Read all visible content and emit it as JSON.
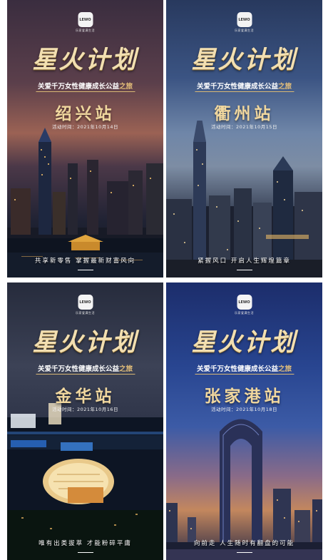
{
  "posters": [
    {
      "logo": "LEWO",
      "logo_sub": "乐家爱满生活",
      "title": "星火计划",
      "subtitle_pre": "关爱千万女性健康成长公益",
      "subtitle_hl": "之旅",
      "station": "绍兴站",
      "date": "活动时间：2021年10月14日",
      "slogan": "共享新零售  掌握最新财富风向"
    },
    {
      "logo": "LEWO",
      "logo_sub": "乐家爱满生活",
      "title": "星火计划",
      "subtitle_pre": "关爱千万女性健康成长公益",
      "subtitle_hl": "之旅",
      "station": "衢州站",
      "date": "活动时间：2021年10月15日",
      "slogan": "紧握风口  开启人生辉煌篇章"
    },
    {
      "logo": "LEWO",
      "logo_sub": "乐家爱满生活",
      "title": "星火计划",
      "subtitle_pre": "关爱千万女性健康成长公益",
      "subtitle_hl": "之旅",
      "station": "金华站",
      "date": "活动时间：2021年10月16日",
      "slogan": "唯有出类拔萃  才能粉碎平庸"
    },
    {
      "logo": "LEWO",
      "logo_sub": "乐家爱满生活",
      "title": "星火计划",
      "subtitle_pre": "关爱千万女性健康成长公益",
      "subtitle_hl": "之旅",
      "station": "张家港站",
      "date": "活动时间：2021年10月18日",
      "slogan": "向前走  人生随时有翻盘的可能"
    }
  ],
  "colors": {
    "gold_title": "#f2dfb1",
    "gold_station": "#f0d79e",
    "gold_highlight": "#e8c27a"
  }
}
